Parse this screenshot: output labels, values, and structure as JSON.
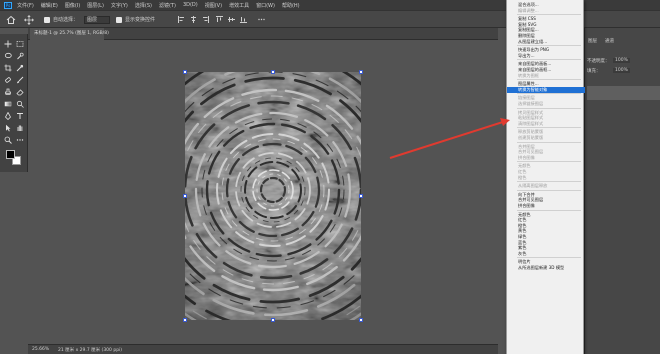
{
  "app": {
    "logo": "Ps",
    "menu": [
      "文件(F)",
      "编辑(E)",
      "图像(I)",
      "图层(L)",
      "文字(Y)",
      "选择(S)",
      "滤镜(T)",
      "3D(D)",
      "视图(V)",
      "增效工具",
      "窗口(W)",
      "帮助(H)"
    ]
  },
  "options": {
    "auto_select_label": "自动选择：",
    "auto_select_value": "图层",
    "show_transform_label": "显示变换控件"
  },
  "document": {
    "tab_label": "未标题-1 @ 25.7% (图层 1, RGB/8)"
  },
  "status": {
    "zoom": "25.66%",
    "info": "21 厘米 x 29.7 厘米 (300 ppi)"
  },
  "panels": {
    "tab_a": "图层",
    "tab_b": "通道",
    "opacity_label": "不透明度：",
    "opacity_value": "100%",
    "fill_label": "填充：",
    "fill_value": "100%"
  },
  "context_menu": {
    "items": [
      {
        "label": "混合选项...",
        "state": "normal"
      },
      {
        "label": "编辑调整...",
        "state": "disabled"
      },
      {
        "sep": true
      },
      {
        "label": "复制 CSS",
        "state": "normal"
      },
      {
        "label": "复制 SVG",
        "state": "normal"
      },
      {
        "label": "复制图层...",
        "state": "normal"
      },
      {
        "label": "删除图层",
        "state": "normal"
      },
      {
        "label": "从图层建立组...",
        "state": "normal"
      },
      {
        "sep": true
      },
      {
        "label": "快速导出为 PNG",
        "state": "normal"
      },
      {
        "label": "导出为...",
        "state": "normal"
      },
      {
        "sep": true
      },
      {
        "label": "来自图层的画板...",
        "state": "normal"
      },
      {
        "label": "来自图层的画框...",
        "state": "normal"
      },
      {
        "label": "转换为图框",
        "state": "disabled"
      },
      {
        "sep": true
      },
      {
        "label": "图层属性...",
        "state": "normal"
      },
      {
        "label": "转换为智能对象",
        "state": "active"
      },
      {
        "sep": true
      },
      {
        "label": "链接图层",
        "state": "disabled"
      },
      {
        "label": "选择链接图层",
        "state": "disabled"
      },
      {
        "sep": true
      },
      {
        "label": "拷贝图层样式",
        "state": "disabled"
      },
      {
        "label": "粘贴图层样式",
        "state": "disabled"
      },
      {
        "label": "清除图层样式",
        "state": "disabled"
      },
      {
        "sep": true
      },
      {
        "label": "释放剪贴蒙版",
        "state": "disabled"
      },
      {
        "label": "创建剪贴蒙版",
        "state": "disabled"
      },
      {
        "sep": true
      },
      {
        "label": "合并图层",
        "state": "disabled"
      },
      {
        "label": "合并可见图层",
        "state": "disabled"
      },
      {
        "label": "拼合图像",
        "state": "disabled"
      },
      {
        "sep": true
      },
      {
        "label": "无颜色",
        "state": "disabled"
      },
      {
        "label": "红色",
        "state": "disabled"
      },
      {
        "label": "橙色",
        "state": "disabled"
      },
      {
        "sep": true
      },
      {
        "label": "从隔离图层释放",
        "state": "disabled"
      },
      {
        "sep": true
      },
      {
        "label": "向下合并",
        "state": "normal"
      },
      {
        "label": "合并可见图层",
        "state": "normal"
      },
      {
        "label": "拼合图像",
        "state": "normal"
      },
      {
        "sep": true
      },
      {
        "label": "无颜色",
        "state": "normal"
      },
      {
        "label": "红色",
        "state": "normal"
      },
      {
        "label": "橙色",
        "state": "normal"
      },
      {
        "label": "黄色",
        "state": "normal"
      },
      {
        "label": "绿色",
        "state": "normal"
      },
      {
        "label": "蓝色",
        "state": "normal"
      },
      {
        "label": "紫色",
        "state": "normal"
      },
      {
        "label": "灰色",
        "state": "normal"
      },
      {
        "sep": true
      },
      {
        "label": "明信片",
        "state": "normal"
      },
      {
        "label": "从所选图层新建 3D 模型",
        "state": "normal"
      }
    ]
  },
  "colors": {
    "accent_highlight": "#1f70d4",
    "arrow": "#e03a2f"
  }
}
